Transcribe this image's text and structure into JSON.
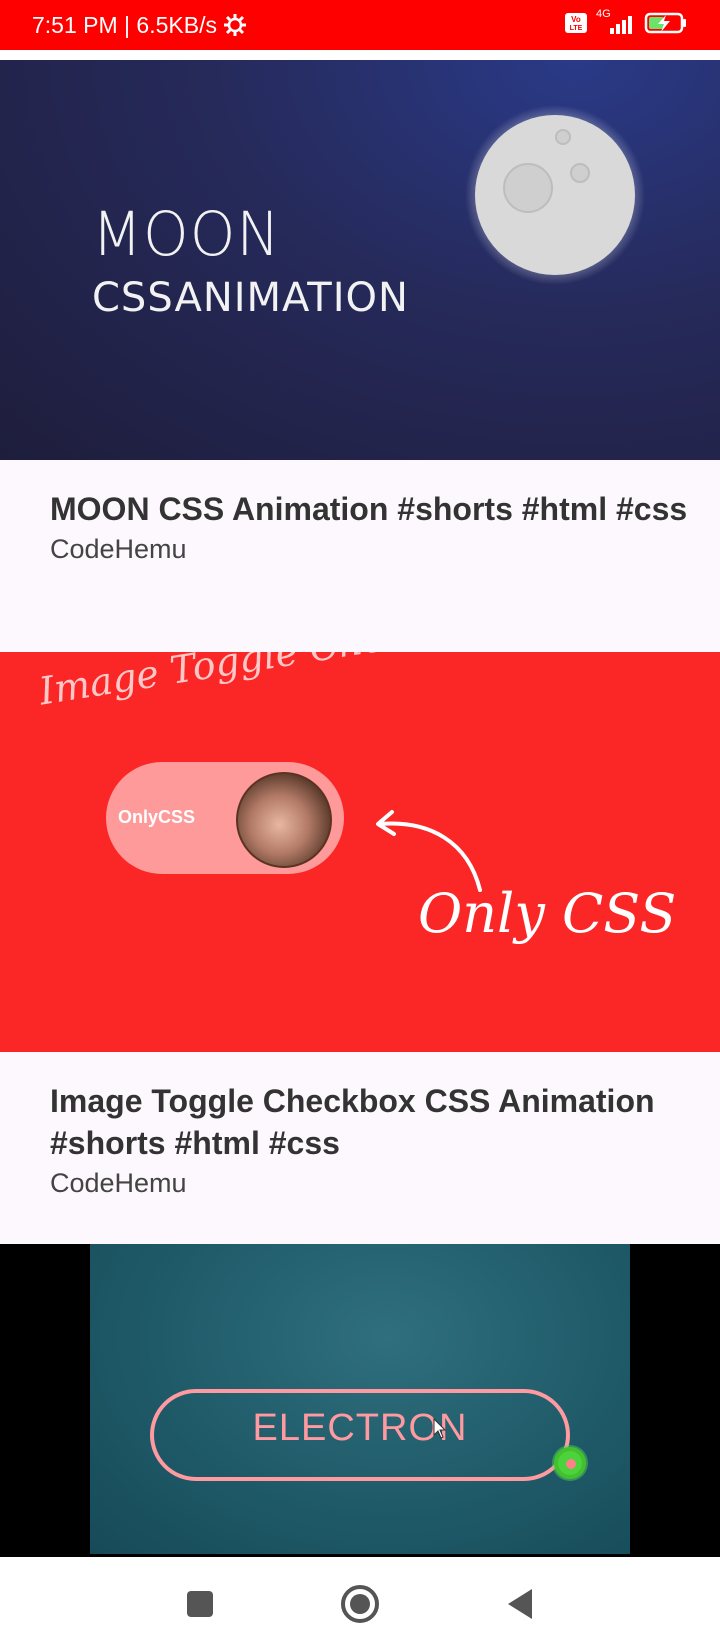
{
  "status_bar": {
    "time_speed": "7:51 PM | 6.5KB/s",
    "network": "4G",
    "background_color": "#ff0000",
    "icons": [
      "gear-icon",
      "volte-icon",
      "signal-icon",
      "battery-charging-icon"
    ]
  },
  "feed": {
    "items": [
      {
        "title": "MOON CSS Animation #shorts #html #css",
        "channel": "CodeHemu",
        "thumbnail": {
          "line1": "MOON",
          "line2": "CSSANIMATION"
        }
      },
      {
        "title": "Image Toggle Checkbox CSS Animation #shorts #html #css",
        "channel": "CodeHemu",
        "thumbnail": {
          "heading": "Image Toggle Checkbox",
          "pill_label": "OnlyCSS",
          "caption": "Only CSS"
        }
      },
      {
        "thumbnail": {
          "label": "ELECTRON"
        }
      }
    ]
  },
  "nav": {
    "icons": [
      "recent-apps-icon",
      "home-icon",
      "back-icon"
    ]
  }
}
